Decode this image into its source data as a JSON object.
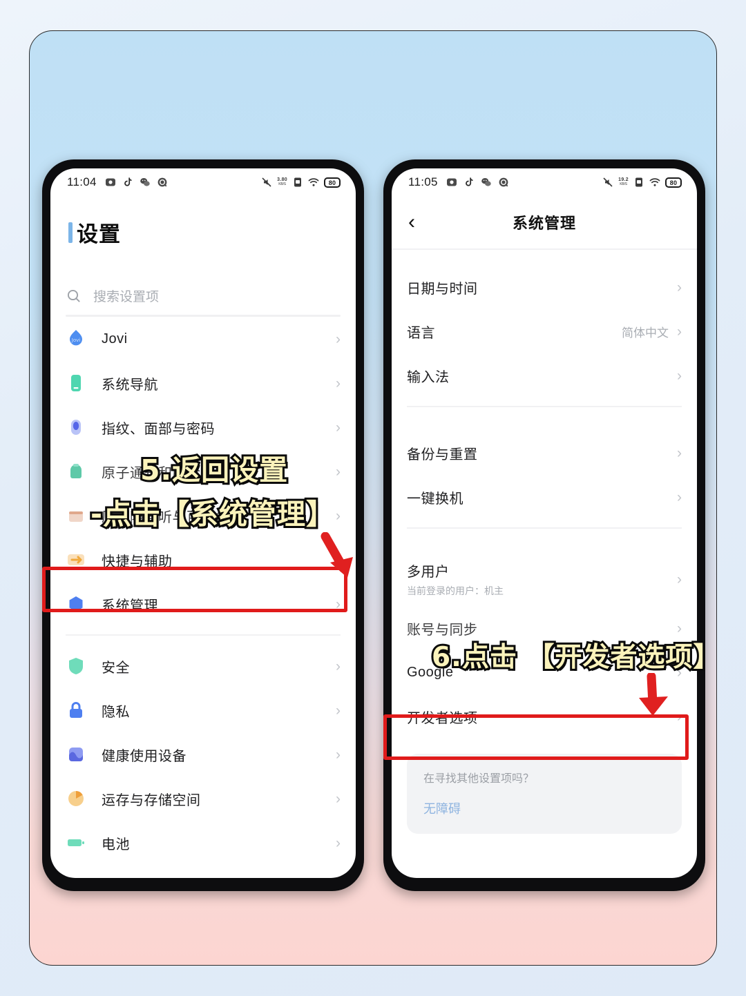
{
  "left_phone": {
    "status_bar": {
      "clock": "11:04",
      "left_icons": [
        "screen-recorder-icon",
        "tiktok-icon",
        "wechat-icon",
        "qq-icon"
      ],
      "mute_icon": "mute-icon",
      "net_speed": "3.80",
      "net_speed_unit": "KB/S",
      "sim_icon": "sim-icon",
      "wifi_icon": "wifi-icon",
      "battery": "80"
    },
    "page_title": "设置",
    "search": {
      "placeholder": "搜索设置项",
      "icon": "search-icon"
    },
    "items": [
      {
        "label": "Jovi",
        "icon": "jovi-icon",
        "color": "#4e8ef0"
      },
      {
        "label": "系统导航",
        "icon": "navigation-icon",
        "color": "#4fd6b0"
      },
      {
        "label": "指纹、面部与密码",
        "icon": "fingerprint-icon",
        "color": "#7a8cf0"
      },
      {
        "label": "原子通知和胶囊",
        "icon": "atomic-notify-icon",
        "color": "#5ec9a8"
      },
      {
        "label": "原子随身听与百宝盒",
        "icon": "atomic-box-icon",
        "color": "#e8b4a0"
      },
      {
        "label": "快捷与辅助",
        "icon": "shortcut-icon",
        "color": "#f0a93c"
      },
      {
        "label": "系统管理",
        "icon": "system-admin-icon",
        "color": "#4e7ff0"
      },
      {
        "label": "安全",
        "icon": "security-icon",
        "color": "#4fd6b0"
      },
      {
        "label": "隐私",
        "icon": "privacy-icon",
        "color": "#4e7ff0"
      },
      {
        "label": "健康使用设备",
        "icon": "wellbeing-icon",
        "color": "#5a68e0"
      },
      {
        "label": "运存与存储空间",
        "icon": "storage-icon",
        "color": "#f0b44c"
      },
      {
        "label": "电池",
        "icon": "battery-icon",
        "color": "#4fd6b0"
      }
    ]
  },
  "right_phone": {
    "status_bar": {
      "clock": "11:05",
      "left_icons": [
        "screen-recorder-icon",
        "tiktok-icon",
        "wechat-icon",
        "qq-icon"
      ],
      "mute_icon": "mute-icon",
      "net_speed": "19.2",
      "net_speed_unit": "KB/S",
      "sim_icon": "sim-icon",
      "wifi_icon": "wifi-icon",
      "battery": "80"
    },
    "nav": {
      "back_icon": "back-chevron-icon",
      "title": "系统管理"
    },
    "group1": [
      {
        "label": "日期与时间",
        "value": ""
      },
      {
        "label": "语言",
        "value": "简体中文"
      },
      {
        "label": "输入法",
        "value": ""
      }
    ],
    "group2": [
      {
        "label": "备份与重置",
        "value": ""
      },
      {
        "label": "一键换机",
        "value": ""
      }
    ],
    "group3_multiuser": {
      "label": "多用户",
      "sublabel": "当前登录的用户：机主"
    },
    "group3": [
      {
        "label": "账号与同步",
        "value": ""
      },
      {
        "label": "Google",
        "value": ""
      },
      {
        "label": "开发者选项",
        "value": ""
      }
    ],
    "hint_card": {
      "question": "在寻找其他设置项吗？",
      "link": "无障碍"
    }
  },
  "annotations": {
    "caption_5_line1": "5.返回设置",
    "caption_5_line2": "-点击【系统管理】",
    "caption_6": "6.点击 【开发者选项】",
    "arrow_left": "red-down-arrow",
    "arrow_right": "red-down-arrow",
    "highlight_left": "系统管理",
    "highlight_right": "开发者选项",
    "highlight_color": "#e01b1b",
    "caption_fill": "#fbf3bb",
    "caption_stroke": "#0a0a0a"
  }
}
